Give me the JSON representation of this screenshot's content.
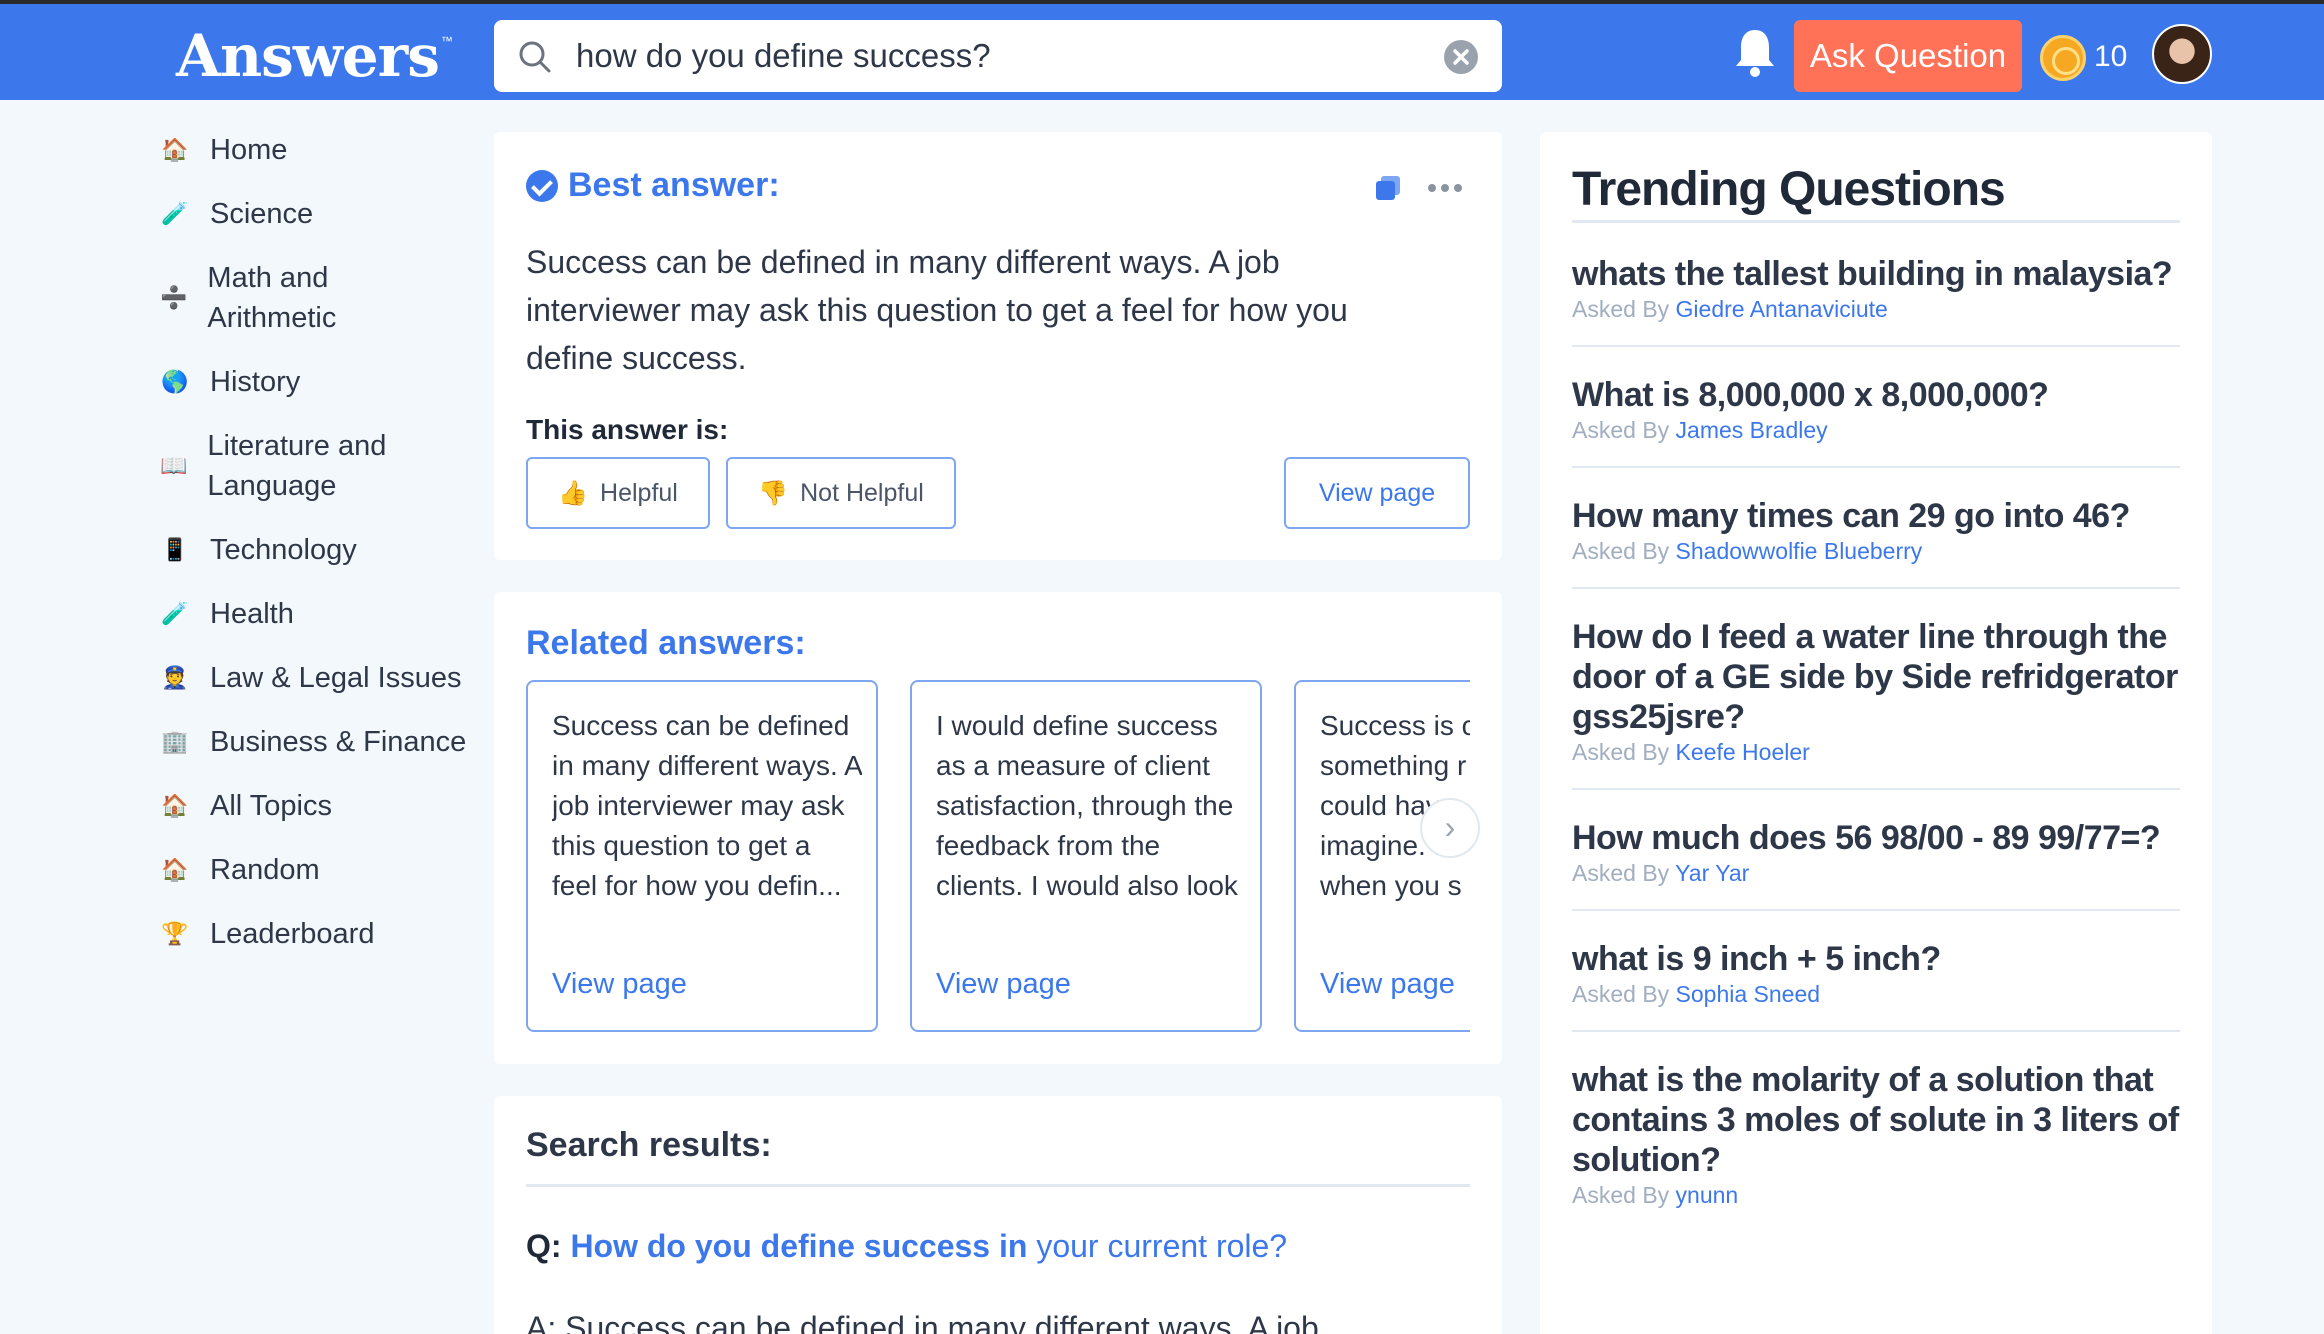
{
  "header": {
    "logo": "Answers",
    "logo_tm": "™",
    "search_value": "how do you define success?",
    "ask_label": "Ask Question",
    "coins": "10"
  },
  "sidebar": {
    "items": [
      {
        "icon": "🏠",
        "label": "Home"
      },
      {
        "icon": "🧪",
        "label": "Science"
      },
      {
        "icon": "➗",
        "label": "Math and Arithmetic"
      },
      {
        "icon": "🌎",
        "label": "History"
      },
      {
        "icon": "📖",
        "label": "Literature and Language"
      },
      {
        "icon": "📱",
        "label": "Technology"
      },
      {
        "icon": "🧪",
        "label": "Health"
      },
      {
        "icon": "👮",
        "label": "Law & Legal Issues"
      },
      {
        "icon": "🏢",
        "label": "Business & Finance"
      },
      {
        "icon": "🏠",
        "label": "All Topics"
      },
      {
        "icon": "🏠",
        "label": "Random"
      },
      {
        "icon": "🏆",
        "label": "Leaderboard"
      }
    ]
  },
  "best_answer": {
    "title": "Best answer:",
    "body": "Success can be defined in many different ways. A job interviewer may ask this question to get a feel for how you define success.",
    "this_answer_is": "This answer is:",
    "helpful": "Helpful",
    "not_helpful": "Not Helpful",
    "view_page": "View page"
  },
  "related": {
    "title": "Related answers:",
    "cards": [
      {
        "text": "Success can be defined in many different ways. A job interviewer may ask this question to get a feel for how you defin...",
        "link": "View page"
      },
      {
        "text": "I would define success as a measure of client satisfaction, through the feedback from the clients. I would also look at how much of...",
        "link": "View page"
      },
      {
        "text": "Success is c something r could hav imagine. I when you s and believin",
        "link": "View page"
      }
    ]
  },
  "search_results": {
    "title": "Search results:",
    "q_label": "Q:",
    "q_bold": "How do you define success in",
    "q_rest": " your current role?",
    "a_text": "A: Success can be defined in many different ways. A job"
  },
  "trending": {
    "title": "Trending Questions",
    "asked_by_label": "Asked By",
    "items": [
      {
        "q": "whats the tallest building in malaysia?",
        "by": "Giedre Antanaviciute"
      },
      {
        "q": "What is 8,000,000 x 8,000,000?",
        "by": "James Bradley"
      },
      {
        "q": "How many times can 29 go into 46?",
        "by": "Shadowwolfie Blueberry"
      },
      {
        "q": "How do I feed a water line through the door of a GE side by Side refridgerator gss25jsre?",
        "by": "Keefe Hoeler"
      },
      {
        "q": "How much does 56 98/00 - 89 99/77=?",
        "by": "Yar Yar"
      },
      {
        "q": "what is 9 inch + 5 inch?",
        "by": "Sophia Sneed"
      },
      {
        "q": "what is the molarity of a solution that contains 3 moles of solute in 3 liters of solution?",
        "by": "ynunn"
      }
    ]
  }
}
